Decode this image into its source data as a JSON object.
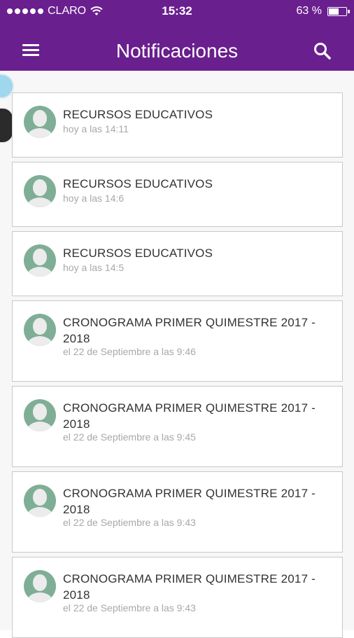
{
  "status": {
    "carrier": "CLARO",
    "time": "15:32",
    "battery": "63 %",
    "battery_level_percent": 63
  },
  "header": {
    "title": "Notificaciones"
  },
  "icons": {
    "menu": "menu-icon",
    "search": "search-icon",
    "avatar": "user-avatar-icon",
    "wifi": "wifi-icon",
    "battery": "battery-icon"
  },
  "colors": {
    "primary": "#6a1f8e",
    "avatar_bg": "#7fae96",
    "title_text": "#333333",
    "time_text": "#a8a8a8"
  },
  "notifications": [
    {
      "title": "RECURSOS EDUCATIVOS",
      "time": "hoy a las 14:11"
    },
    {
      "title": "RECURSOS EDUCATIVOS",
      "time": "hoy a las 14:6"
    },
    {
      "title": "RECURSOS EDUCATIVOS",
      "time": "hoy a las 14:5"
    },
    {
      "title": "CRONOGRAMA PRIMER QUIMESTRE 2017 - 2018",
      "time": "el 22 de Septiembre a las 9:46"
    },
    {
      "title": "CRONOGRAMA PRIMER QUIMESTRE 2017 - 2018",
      "time": "el 22 de Septiembre a las 9:45"
    },
    {
      "title": "CRONOGRAMA PRIMER QUIMESTRE 2017 - 2018",
      "time": "el 22 de Septiembre a las 9:43"
    },
    {
      "title": "CRONOGRAMA PRIMER QUIMESTRE 2017 - 2018",
      "time": "el 22 de Septiembre a las 9:43"
    }
  ]
}
